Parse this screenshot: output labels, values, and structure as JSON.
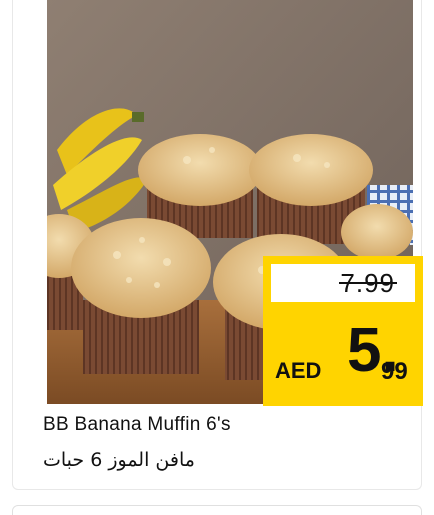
{
  "product": {
    "name_en": "BB Banana Muffin 6's",
    "name_ar": "مافن الموز 6 حبات"
  },
  "price": {
    "old": "7.99",
    "currency": "AED",
    "new_int": "5.",
    "new_dec": "99"
  },
  "colors": {
    "price_tag": "#ffd400",
    "card_border": "#e8e8e8"
  }
}
